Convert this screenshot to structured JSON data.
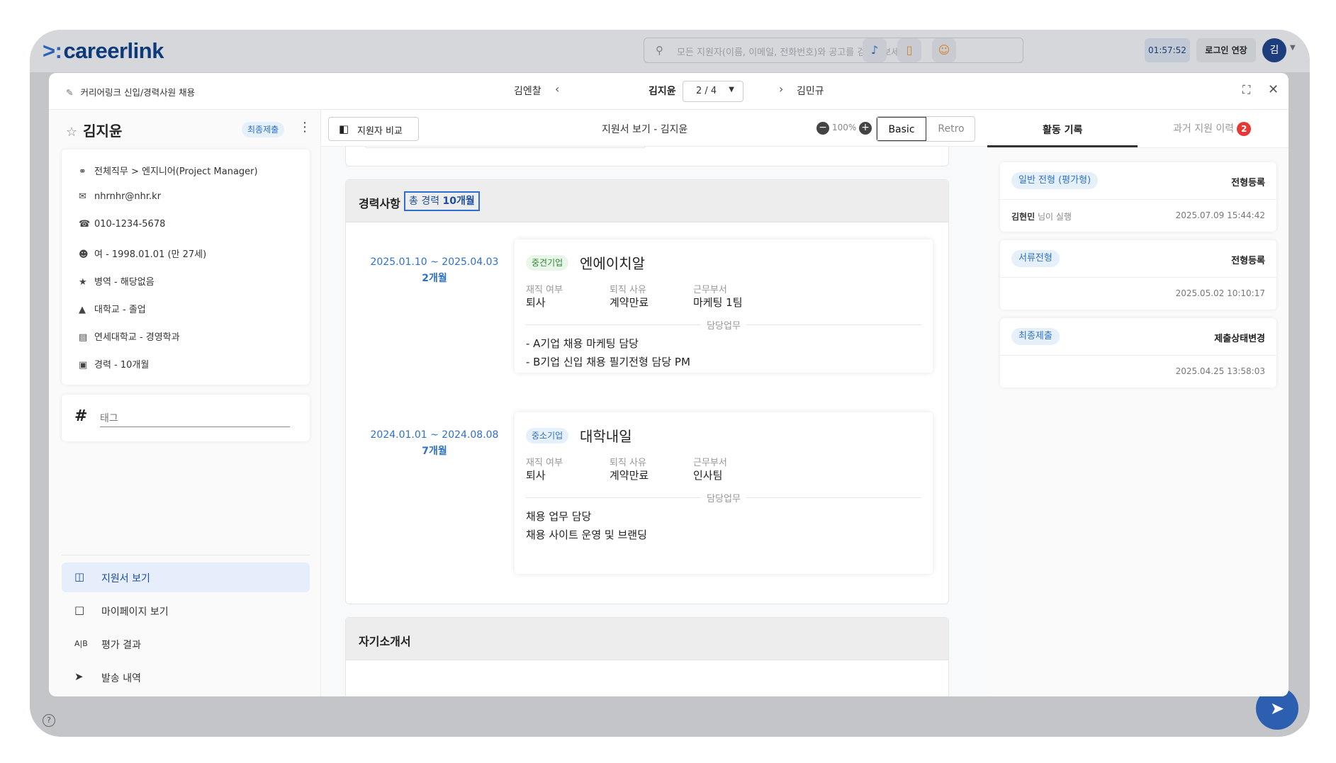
{
  "app": {
    "logo": "careerlink",
    "search_placeholder": "모든 지원자(이름, 이메일, 전화번호)와 공고를 검색해보세요",
    "timer": "01:57:52",
    "login_extend": "로그인 연장",
    "avatar": "김"
  },
  "modal": {
    "title": "커리어링크 신입/경력사원 채용",
    "prev_applicant": "김엔찰",
    "current_applicant": "김지윤",
    "pager": "2 / 4",
    "next_applicant": "김민규"
  },
  "profile": {
    "name": "김지윤",
    "status_badge": "최종제출",
    "info": [
      {
        "icon": "tag-icon",
        "text": "전체직무 > 엔지니어(Project Manager)"
      },
      {
        "icon": "mail-icon",
        "text": "nhrnhr@nhr.kr"
      },
      {
        "icon": "phone-icon",
        "text": "010-1234-5678"
      },
      {
        "icon": "person-icon",
        "text": "여 - 1998.01.01 (만 27세)"
      },
      {
        "icon": "medal-icon",
        "text": "병역 - 해당없음"
      },
      {
        "icon": "graduation-icon",
        "text": "대학교 - 졸업"
      },
      {
        "icon": "book-icon",
        "text": "연세대학교 - 경영학과"
      },
      {
        "icon": "briefcase-icon",
        "text": "경력 - 10개월"
      }
    ],
    "tag_placeholder": "태그"
  },
  "left_menu": [
    {
      "label": "지원서 보기",
      "icon": "clipboard-search-icon",
      "active": true
    },
    {
      "label": "마이페이지 보기",
      "icon": "clipboard-icon",
      "active": false
    },
    {
      "label": "평가 결과",
      "icon": "ab-icon",
      "active": false
    },
    {
      "label": "발송 내역",
      "icon": "send-icon",
      "active": false
    }
  ],
  "viewer": {
    "compare_button": "지원자 비교",
    "title": "지원서 보기 - 김지윤",
    "zoom": "100%",
    "mode_basic": "Basic",
    "mode_retro": "Retro"
  },
  "career": {
    "section_title": "경력사항",
    "total_prefix": "총 경력",
    "total_value": "10개월",
    "entries": [
      {
        "period": "2025.01.10 ~ 2025.04.03",
        "duration": "2개월",
        "company_type": "중견기업",
        "company": "엔에이치알",
        "employment_label": "재직 여부",
        "employment": "퇴사",
        "reason_label": "퇴직 사유",
        "reason": "계약만료",
        "dept_label": "근무부서",
        "dept": "마케팅 1팀",
        "duty_label": "담당업무",
        "duties": [
          "- A기업 채용 마케팅 담당",
          "- B기업 신입 채용 필기전형 담당 PM"
        ]
      },
      {
        "period": "2024.01.01 ~ 2024.08.08",
        "duration": "7개월",
        "company_type": "중소기업",
        "company": "대학내일",
        "employment_label": "재직 여부",
        "employment": "퇴사",
        "reason_label": "퇴직 사유",
        "reason": "계약만료",
        "dept_label": "근무부서",
        "dept": "인사팀",
        "duty_label": "담당업무",
        "duties": [
          "채용 업무 담당",
          "채용 사이트 운영 및 브랜딩"
        ]
      }
    ]
  },
  "intro": {
    "section_title": "자기소개서"
  },
  "activity": {
    "tab_log": "활동 기록",
    "tab_history": "과거 지원 이력",
    "history_count": "2",
    "items": [
      {
        "stage": "일반 전형 (평가형)",
        "kind": "전형등록",
        "actor": "김현민",
        "actor_suffix": "님이 실행",
        "time": "2025.07.09 15:44:42"
      },
      {
        "stage": "서류전형",
        "kind": "전형등록",
        "actor": "",
        "actor_suffix": "",
        "time": "2025.05.02 10:10:17"
      },
      {
        "stage": "최종제출",
        "kind": "제출상태변경",
        "actor": "",
        "actor_suffix": "",
        "time": "2025.04.25 13:58:03"
      }
    ]
  }
}
